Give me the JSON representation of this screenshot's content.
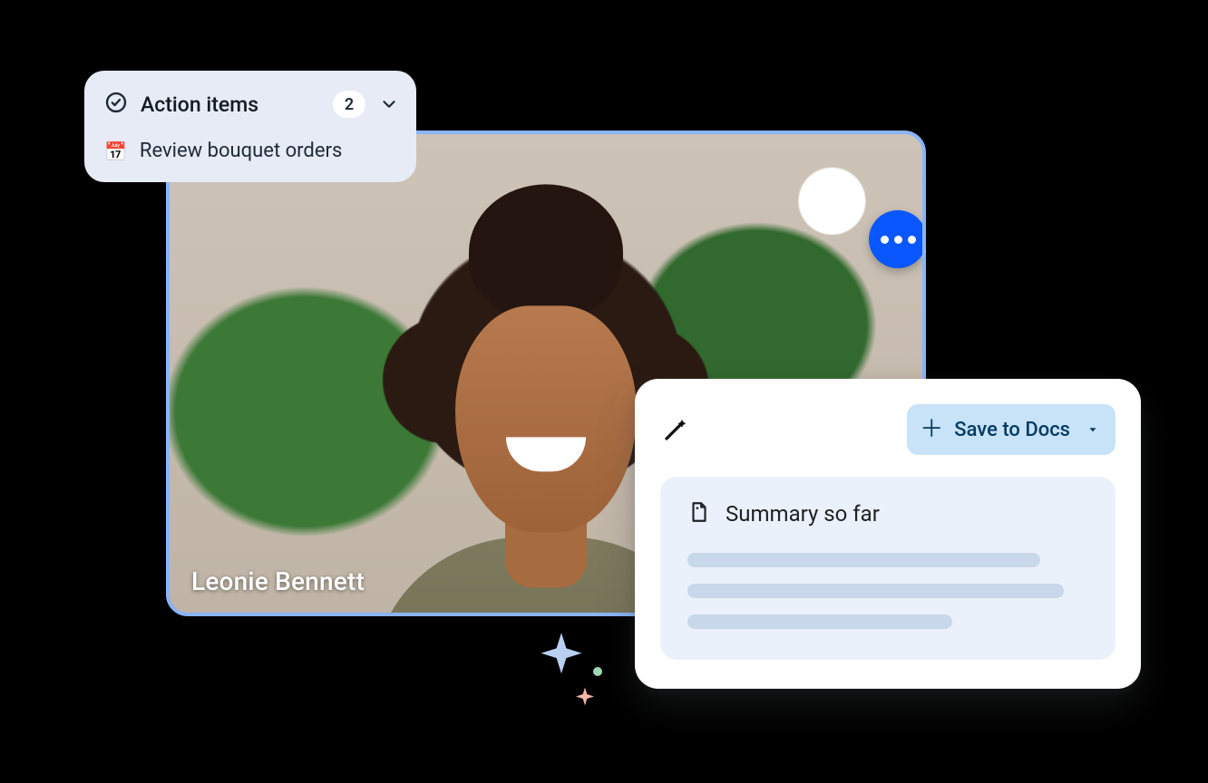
{
  "action_items": {
    "title": "Action items",
    "count": "2",
    "items": [
      {
        "icon": "📅",
        "label": "Review bouquet orders"
      }
    ]
  },
  "video": {
    "participant_name": "Leonie Bennett"
  },
  "summary": {
    "save_button": "Save to Docs",
    "section_title": "Summary so far"
  }
}
